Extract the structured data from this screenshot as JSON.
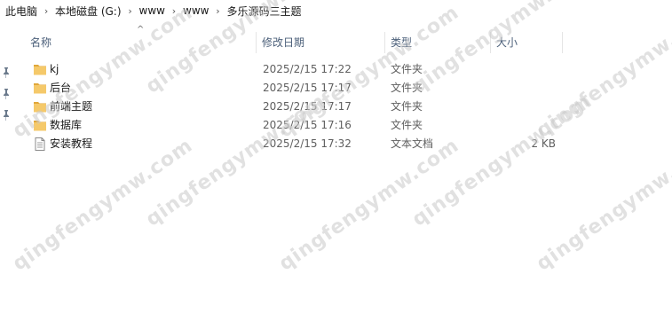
{
  "breadcrumb": {
    "items": [
      "此电脑",
      "本地磁盘 (G:)",
      "www",
      "www",
      "多乐源码三主题"
    ],
    "separator": "›"
  },
  "columns": {
    "name": "名称",
    "date": "修改日期",
    "type": "类型",
    "size": "大小"
  },
  "files": [
    {
      "name": "kj",
      "date": "2025/2/15 17:22",
      "type": "文件夹",
      "size": "",
      "icon": "folder-icon"
    },
    {
      "name": "后台",
      "date": "2025/2/15 17:17",
      "type": "文件夹",
      "size": "",
      "icon": "folder-icon"
    },
    {
      "name": "前端主题",
      "date": "2025/2/15 17:17",
      "type": "文件夹",
      "size": "",
      "icon": "folder-icon"
    },
    {
      "name": "数据库",
      "date": "2025/2/15 17:16",
      "type": "文件夹",
      "size": "",
      "icon": "folder-icon"
    },
    {
      "name": "安装教程",
      "date": "2025/2/15 17:32",
      "type": "文本文档",
      "size": "2 KB",
      "icon": "text-file-icon"
    }
  ],
  "watermark_text": "qingfengymw.com",
  "colors": {
    "folder": "#f5c96a",
    "folder_dark": "#e0a73a",
    "header_text": "#4c607a",
    "pin": "#6b7a8c"
  }
}
